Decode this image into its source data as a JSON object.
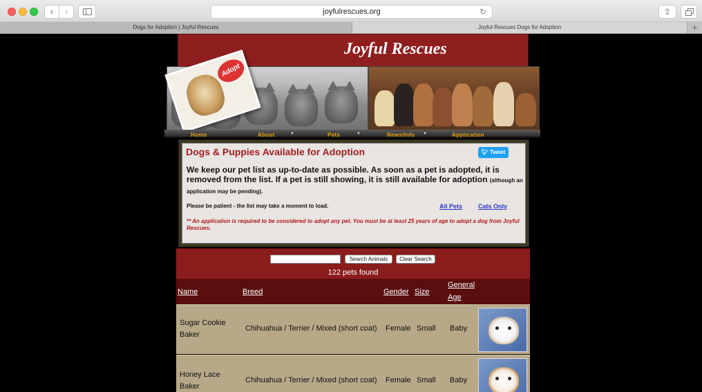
{
  "browser": {
    "url": "joyfulrescues.org",
    "tabs": [
      {
        "label": "Dogs for Adoption | Joyful Rescues"
      },
      {
        "label": "Joyful Rescues Dogs for Adoption"
      }
    ],
    "icons": [
      "back-icon",
      "forward-icon",
      "sidebar-icon",
      "reload-icon",
      "share-icon",
      "tabs-overview-icon",
      "new-tab-icon"
    ]
  },
  "site": {
    "title": "Joyful Rescues",
    "adopt_sign": "Adopt"
  },
  "menu": {
    "items": [
      "Home",
      "About",
      "Pets",
      "News/Info",
      "Application"
    ]
  },
  "content": {
    "title": "Dogs & Puppies Available for Adoption",
    "tweet_label": "Tweet",
    "intro_main": "We keep our pet list as up-to-date as possible. As soon as a pet is adopted, it is removed from the list. If a pet is still showing, it is still available for adoption",
    "intro_small": "(although an application may be pending).",
    "patience": "Please be patient - the list may take a moment to load.",
    "link_all": "All Pets",
    "link_cats": "Cats Only",
    "note": "** An application is required to be considered to adopt any pet. You must be at least 25 years of age to adopt a dog from Joyful Rescues."
  },
  "search": {
    "input_value": "",
    "search_button": "Search Animals",
    "clear_button": "Clear Search",
    "found_text": "122 pets found"
  },
  "table": {
    "headers": {
      "name": "Name",
      "breed": "Breed",
      "gender": "Gender",
      "size": "Size",
      "general": "General",
      "age": "Age"
    },
    "rows": [
      {
        "name_line1": "Sugar Cookie",
        "name_line2": "Baker",
        "breed": "Chihuahua / Terrier / Mixed (short coat)",
        "gender": "Female",
        "size": "Small",
        "age": "Baby"
      },
      {
        "name_line1": "Honey Lace",
        "name_line2": "Baker",
        "breed": "Chihuahua / Terrier / Mixed (short coat)",
        "gender": "Female",
        "size": "Small",
        "age": "Baby"
      }
    ]
  }
}
